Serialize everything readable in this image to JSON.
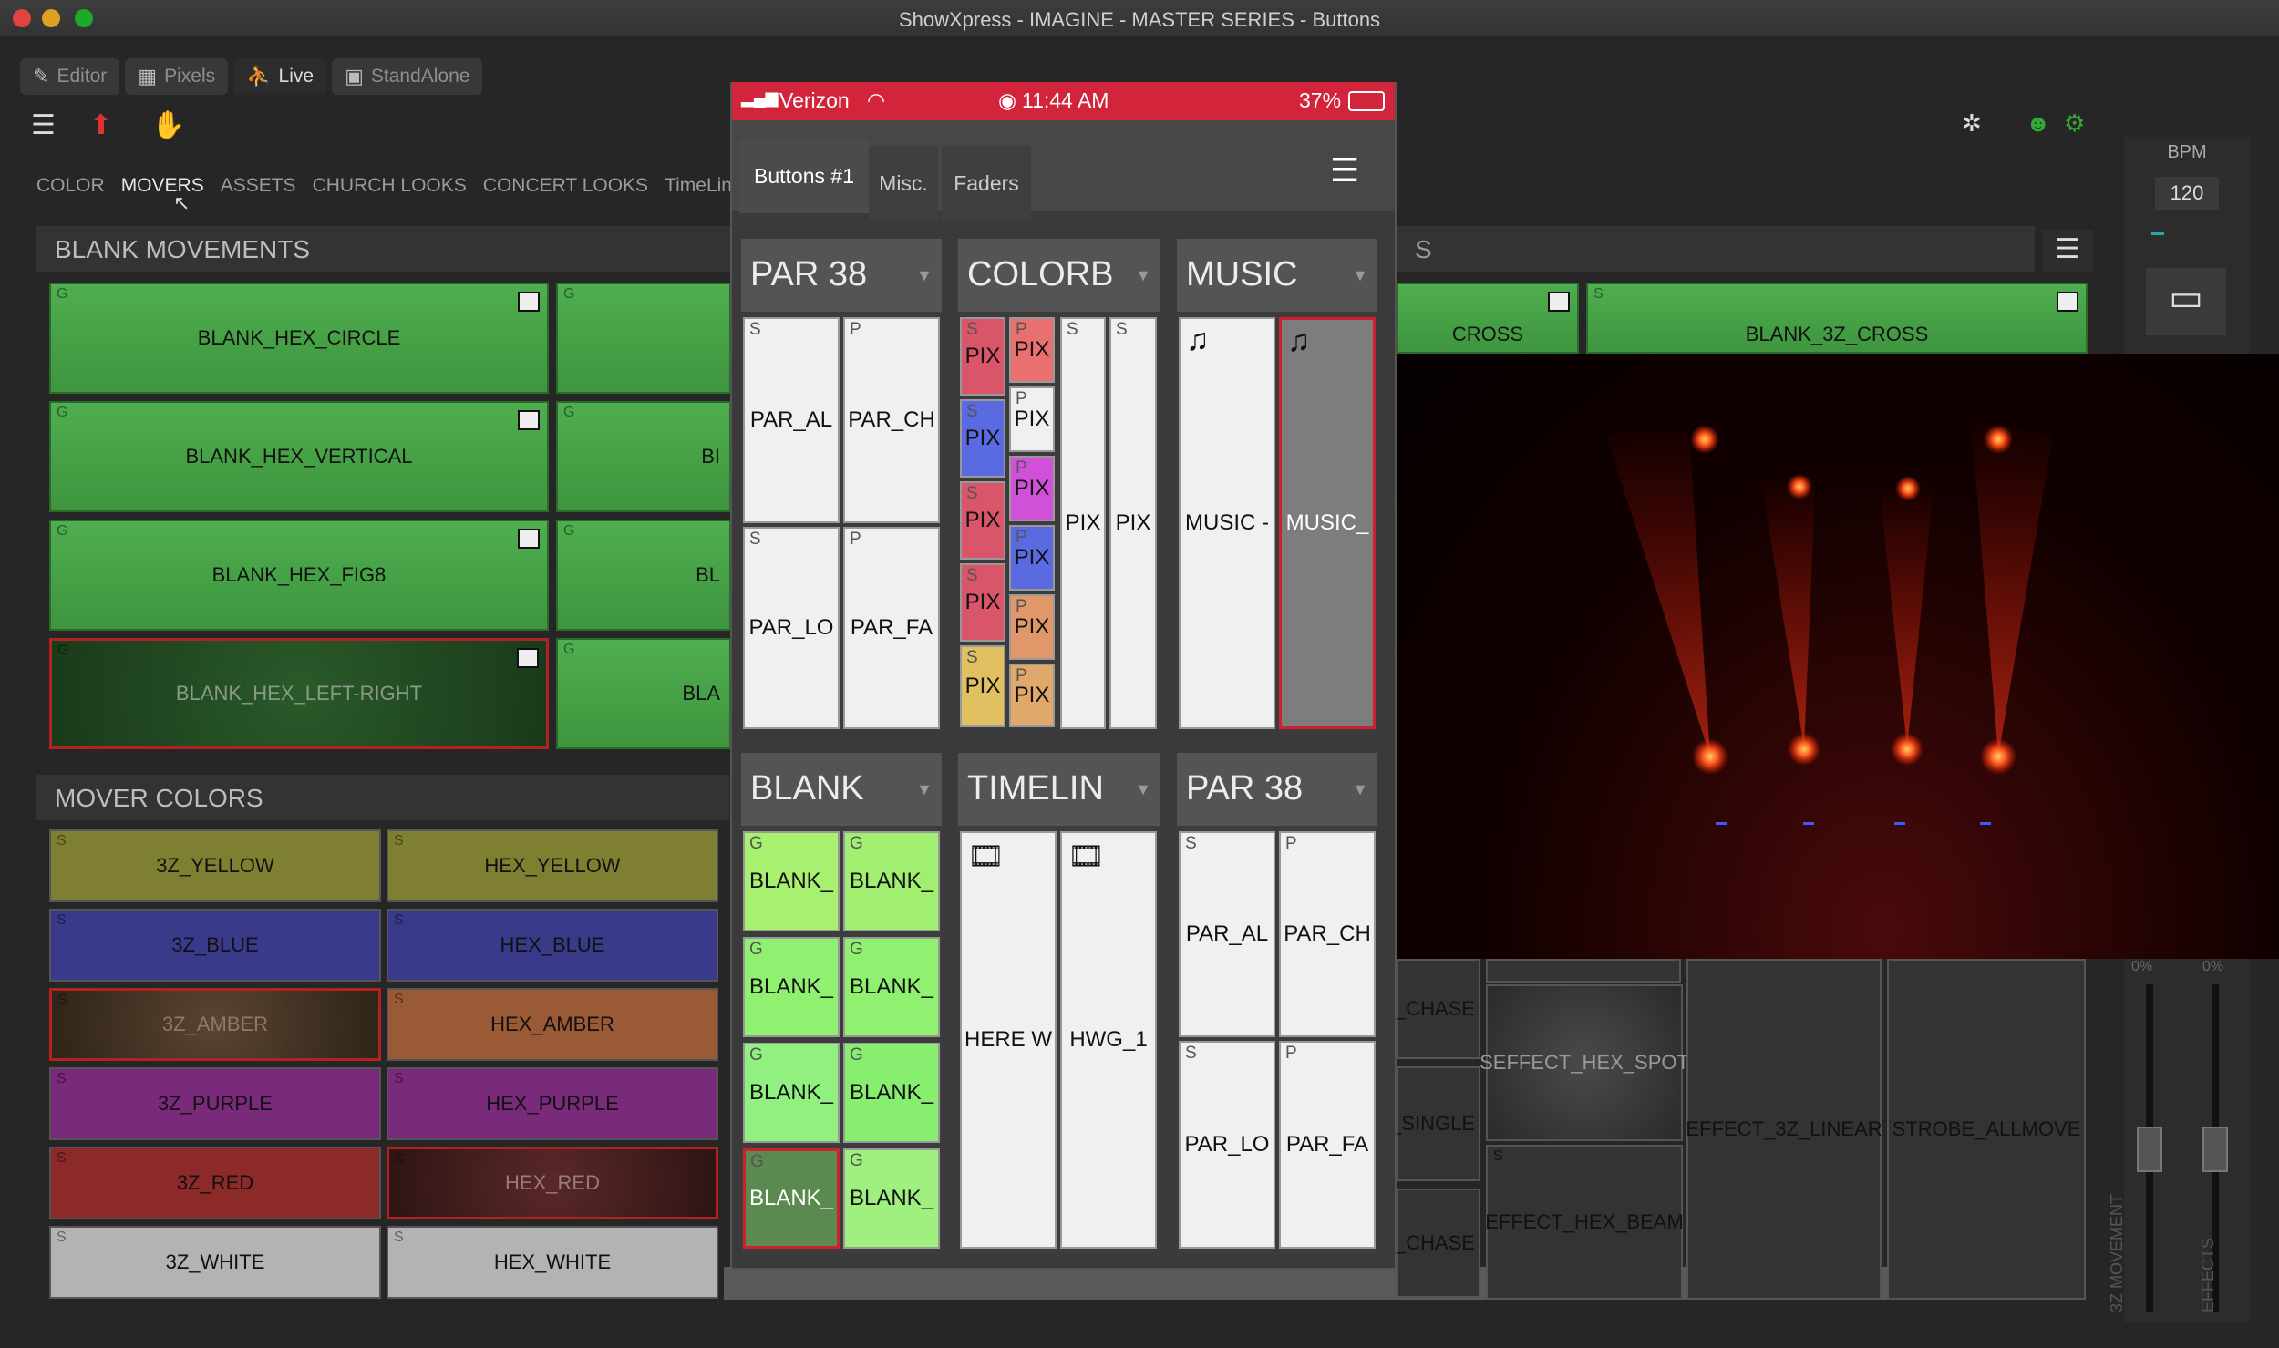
{
  "window": {
    "title": "ShowXpress - IMAGINE - MASTER SERIES - Buttons"
  },
  "modes": [
    "Editor",
    "Pixels",
    "Live",
    "StandAlone"
  ],
  "categories": [
    "COLOR",
    "MOVERS",
    "ASSETS",
    "CHURCH LOOKS",
    "CONCERT LOOKS",
    "TimeLin"
  ],
  "blank_movements": {
    "title": "BLANK MOVEMENTS",
    "buttons": [
      "BLANK_HEX_CIRCLE",
      "BLANK_HEX_VERTICAL",
      "BLANK_HEX_FIG8",
      "BLANK_HEX_LEFT-RIGHT"
    ],
    "partial": [
      "BI",
      "BL",
      "BLA"
    ],
    "right": [
      "CROSS",
      "BLANK_3Z_CROSS"
    ]
  },
  "mover_colors": {
    "title": "MOVER COLORS",
    "rows": [
      [
        "3Z_YELLOW",
        "HEX_YELLOW"
      ],
      [
        "3Z_BLUE",
        "HEX_BLUE"
      ],
      [
        "3Z_AMBER",
        "HEX_AMBER"
      ],
      [
        "3Z_PURPLE",
        "HEX_PURPLE"
      ],
      [
        "3Z_RED",
        "HEX_RED"
      ],
      [
        "3Z_WHITE",
        "HEX_WHITE"
      ]
    ]
  },
  "right_effects": {
    "labels": [
      "_CHASE",
      "_SINGLE",
      "_CHASE",
      "EFFECT_HEX_SPOT",
      "EFFECT_3Z_LINEAR",
      "STROBE_ALLMOVE",
      "EFFECT_HEX_BEAM"
    ],
    "faders": [
      "3Z MOVEMENT",
      "EFFECTS"
    ],
    "fader_values": [
      "0%",
      "0%"
    ]
  },
  "bpm": {
    "label": "BPM",
    "value": "120"
  },
  "phone": {
    "carrier": "Verizon",
    "time": "11:44 AM",
    "battery": "37%",
    "tabs": [
      "Buttons #1",
      "Misc.",
      "Faders"
    ],
    "groups": [
      {
        "title": "PAR 38",
        "buttons": [
          "PAR_AL",
          "PAR_CH",
          "PAR_LO",
          "PAR_FA"
        ]
      },
      {
        "title": "COLORB",
        "buttons": [
          "PIX",
          "PIX",
          "PIX",
          "PIX",
          "PIX",
          "PIX",
          "PIX",
          "PIX",
          "PIX",
          "PIX",
          "PIX",
          "PIX"
        ]
      },
      {
        "title": "MUSIC",
        "buttons": [
          "MUSIC -",
          "MUSIC_"
        ]
      },
      {
        "title": "BLANK",
        "buttons": [
          "BLANK_",
          "BLANK_",
          "BLANK_",
          "BLANK_",
          "BLANK_",
          "BLANK_",
          "BLANK_",
          "BLANK_"
        ]
      },
      {
        "title": "TIMELIN",
        "buttons": [
          "HERE W",
          "HWG_1"
        ]
      },
      {
        "title": "PAR 38",
        "buttons": [
          "PAR_AL",
          "PAR_CH",
          "PAR_LO",
          "PAR_FA"
        ]
      }
    ],
    "corner_marks": {
      "s": "S",
      "p": "P",
      "g": "G"
    }
  },
  "colors": {
    "status_red": "#d2243a",
    "green_button": "#4fae4f",
    "selected_border": "#b52020",
    "yellow": "#7f7f32",
    "blue": "#3a3a8a",
    "purple": "#7a2a7a",
    "red": "#8c2a2a",
    "amber": "#9a5a35"
  }
}
